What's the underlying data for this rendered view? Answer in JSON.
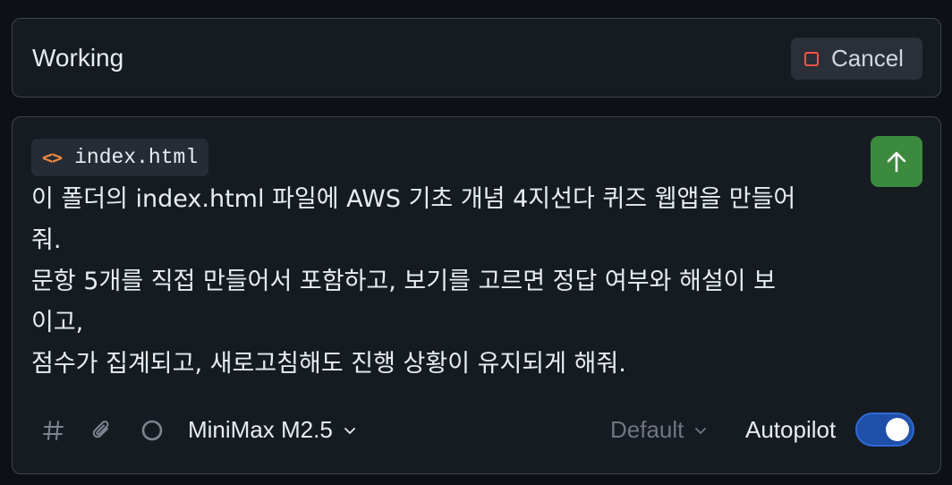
{
  "status": {
    "text": "Working",
    "cancel_label": "Cancel"
  },
  "composer": {
    "attachment": {
      "icon": "code-icon",
      "file_name": "index.html"
    },
    "prompt_text": "이 폴더의 index.html 파일에 AWS 기초 개념 4지선다 퀴즈 웹앱을 만들어\n줘.\n문항 5개를 직접 만들어서 포함하고, 보기를 고르면 정답 여부와 해설이 보\n이고,\n점수가 집계되고, 새로고침해도 진행 상황이 유지되게 해줘.",
    "send_icon": "arrow-up-icon"
  },
  "toolbar": {
    "icons": [
      "hash-icon",
      "paperclip-icon",
      "progress-ring-icon"
    ],
    "model_label": "MiniMax M2.5",
    "mode_label": "Default",
    "autopilot_label": "Autopilot",
    "autopilot_on": true
  },
  "colors": {
    "background": "#0d1117",
    "panel": "#161b22",
    "send_button": "#3b8a3e",
    "cancel_stop": "#f85149",
    "toggle_on": "#1f4fa8",
    "code_icon": "#f0883e"
  }
}
